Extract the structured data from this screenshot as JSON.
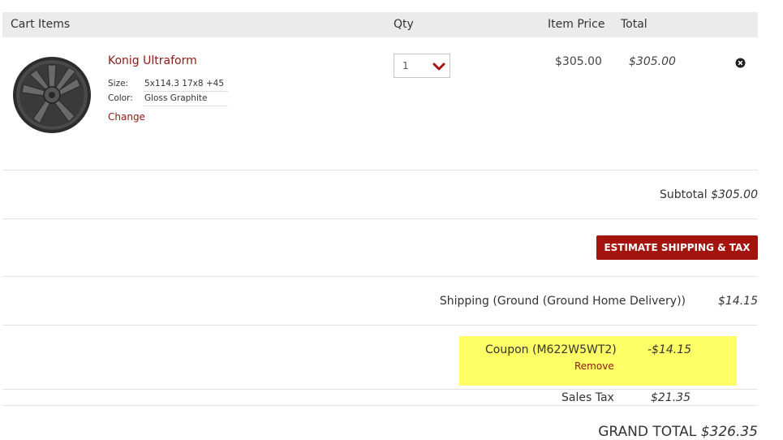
{
  "header": {
    "cart_items": "Cart Items",
    "qty": "Qty",
    "item_price": "Item Price",
    "total": "Total"
  },
  "item": {
    "name": "Konig Ultraform",
    "size_label": "Size:",
    "size_value": "5x114.3 17x8 +45",
    "color_label": "Color:",
    "color_value": "Gloss Graphite",
    "change": "Change",
    "qty": "1",
    "price": "$305.00",
    "total": "$305.00",
    "image_icon": "wheel-image",
    "remove_icon": "close-circle-icon"
  },
  "summary": {
    "subtotal_label": "Subtotal",
    "subtotal_amount": "$305.00",
    "estimate_button": "ESTIMATE SHIPPING & TAX",
    "shipping_label": "Shipping (Ground (Ground Home Delivery))",
    "shipping_amount": "$14.15",
    "coupon_label": "Coupon (M622W5WT2)",
    "coupon_amount": "-$14.15",
    "coupon_remove": "Remove",
    "tax_label": "Sales Tax",
    "tax_amount": "$21.35",
    "grand_label": "GRAND TOTAL",
    "grand_amount": "$326.35"
  },
  "colors": {
    "accent": "#a3140f",
    "link": "#8b1a14",
    "coupon_highlight": "#ffff66",
    "header_bg": "#ebebeb"
  }
}
